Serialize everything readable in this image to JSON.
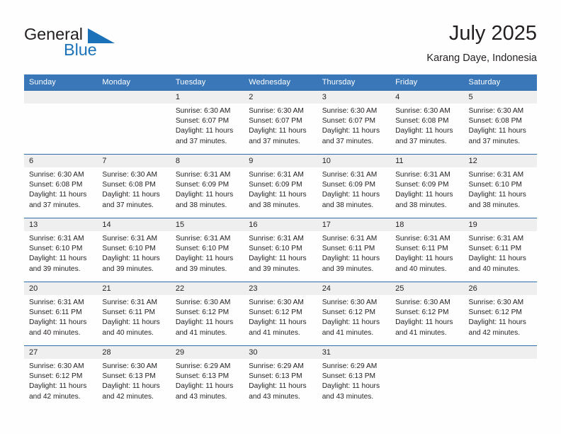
{
  "brand": {
    "name_top": "General",
    "name_bottom": "Blue",
    "triangle_color": "#1b72b8",
    "text_color": "#231f20",
    "blue_color": "#1b72b8"
  },
  "header": {
    "title": "July 2025",
    "subtitle": "Karang Daye, Indonesia"
  },
  "theme": {
    "header_blue": "#3a77b8",
    "rule_blue": "#2f6da8",
    "daynum_band": "#efefef",
    "text": "#231f20"
  },
  "calendar": {
    "weekdays": [
      "Sunday",
      "Monday",
      "Tuesday",
      "Wednesday",
      "Thursday",
      "Friday",
      "Saturday"
    ],
    "weeks": [
      [
        {
          "day": "",
          "empty": true
        },
        {
          "day": "",
          "empty": true
        },
        {
          "day": "1",
          "sunrise": "Sunrise: 6:30 AM",
          "sunset": "Sunset: 6:07 PM",
          "daylight1": "Daylight: 11 hours",
          "daylight2": "and 37 minutes."
        },
        {
          "day": "2",
          "sunrise": "Sunrise: 6:30 AM",
          "sunset": "Sunset: 6:07 PM",
          "daylight1": "Daylight: 11 hours",
          "daylight2": "and 37 minutes."
        },
        {
          "day": "3",
          "sunrise": "Sunrise: 6:30 AM",
          "sunset": "Sunset: 6:07 PM",
          "daylight1": "Daylight: 11 hours",
          "daylight2": "and 37 minutes."
        },
        {
          "day": "4",
          "sunrise": "Sunrise: 6:30 AM",
          "sunset": "Sunset: 6:08 PM",
          "daylight1": "Daylight: 11 hours",
          "daylight2": "and 37 minutes."
        },
        {
          "day": "5",
          "sunrise": "Sunrise: 6:30 AM",
          "sunset": "Sunset: 6:08 PM",
          "daylight1": "Daylight: 11 hours",
          "daylight2": "and 37 minutes."
        }
      ],
      [
        {
          "day": "6",
          "sunrise": "Sunrise: 6:30 AM",
          "sunset": "Sunset: 6:08 PM",
          "daylight1": "Daylight: 11 hours",
          "daylight2": "and 37 minutes."
        },
        {
          "day": "7",
          "sunrise": "Sunrise: 6:30 AM",
          "sunset": "Sunset: 6:08 PM",
          "daylight1": "Daylight: 11 hours",
          "daylight2": "and 37 minutes."
        },
        {
          "day": "8",
          "sunrise": "Sunrise: 6:31 AM",
          "sunset": "Sunset: 6:09 PM",
          "daylight1": "Daylight: 11 hours",
          "daylight2": "and 38 minutes."
        },
        {
          "day": "9",
          "sunrise": "Sunrise: 6:31 AM",
          "sunset": "Sunset: 6:09 PM",
          "daylight1": "Daylight: 11 hours",
          "daylight2": "and 38 minutes."
        },
        {
          "day": "10",
          "sunrise": "Sunrise: 6:31 AM",
          "sunset": "Sunset: 6:09 PM",
          "daylight1": "Daylight: 11 hours",
          "daylight2": "and 38 minutes."
        },
        {
          "day": "11",
          "sunrise": "Sunrise: 6:31 AM",
          "sunset": "Sunset: 6:09 PM",
          "daylight1": "Daylight: 11 hours",
          "daylight2": "and 38 minutes."
        },
        {
          "day": "12",
          "sunrise": "Sunrise: 6:31 AM",
          "sunset": "Sunset: 6:10 PM",
          "daylight1": "Daylight: 11 hours",
          "daylight2": "and 38 minutes."
        }
      ],
      [
        {
          "day": "13",
          "sunrise": "Sunrise: 6:31 AM",
          "sunset": "Sunset: 6:10 PM",
          "daylight1": "Daylight: 11 hours",
          "daylight2": "and 39 minutes."
        },
        {
          "day": "14",
          "sunrise": "Sunrise: 6:31 AM",
          "sunset": "Sunset: 6:10 PM",
          "daylight1": "Daylight: 11 hours",
          "daylight2": "and 39 minutes."
        },
        {
          "day": "15",
          "sunrise": "Sunrise: 6:31 AM",
          "sunset": "Sunset: 6:10 PM",
          "daylight1": "Daylight: 11 hours",
          "daylight2": "and 39 minutes."
        },
        {
          "day": "16",
          "sunrise": "Sunrise: 6:31 AM",
          "sunset": "Sunset: 6:10 PM",
          "daylight1": "Daylight: 11 hours",
          "daylight2": "and 39 minutes."
        },
        {
          "day": "17",
          "sunrise": "Sunrise: 6:31 AM",
          "sunset": "Sunset: 6:11 PM",
          "daylight1": "Daylight: 11 hours",
          "daylight2": "and 39 minutes."
        },
        {
          "day": "18",
          "sunrise": "Sunrise: 6:31 AM",
          "sunset": "Sunset: 6:11 PM",
          "daylight1": "Daylight: 11 hours",
          "daylight2": "and 40 minutes."
        },
        {
          "day": "19",
          "sunrise": "Sunrise: 6:31 AM",
          "sunset": "Sunset: 6:11 PM",
          "daylight1": "Daylight: 11 hours",
          "daylight2": "and 40 minutes."
        }
      ],
      [
        {
          "day": "20",
          "sunrise": "Sunrise: 6:31 AM",
          "sunset": "Sunset: 6:11 PM",
          "daylight1": "Daylight: 11 hours",
          "daylight2": "and 40 minutes."
        },
        {
          "day": "21",
          "sunrise": "Sunrise: 6:31 AM",
          "sunset": "Sunset: 6:11 PM",
          "daylight1": "Daylight: 11 hours",
          "daylight2": "and 40 minutes."
        },
        {
          "day": "22",
          "sunrise": "Sunrise: 6:30 AM",
          "sunset": "Sunset: 6:12 PM",
          "daylight1": "Daylight: 11 hours",
          "daylight2": "and 41 minutes."
        },
        {
          "day": "23",
          "sunrise": "Sunrise: 6:30 AM",
          "sunset": "Sunset: 6:12 PM",
          "daylight1": "Daylight: 11 hours",
          "daylight2": "and 41 minutes."
        },
        {
          "day": "24",
          "sunrise": "Sunrise: 6:30 AM",
          "sunset": "Sunset: 6:12 PM",
          "daylight1": "Daylight: 11 hours",
          "daylight2": "and 41 minutes."
        },
        {
          "day": "25",
          "sunrise": "Sunrise: 6:30 AM",
          "sunset": "Sunset: 6:12 PM",
          "daylight1": "Daylight: 11 hours",
          "daylight2": "and 41 minutes."
        },
        {
          "day": "26",
          "sunrise": "Sunrise: 6:30 AM",
          "sunset": "Sunset: 6:12 PM",
          "daylight1": "Daylight: 11 hours",
          "daylight2": "and 42 minutes."
        }
      ],
      [
        {
          "day": "27",
          "sunrise": "Sunrise: 6:30 AM",
          "sunset": "Sunset: 6:12 PM",
          "daylight1": "Daylight: 11 hours",
          "daylight2": "and 42 minutes."
        },
        {
          "day": "28",
          "sunrise": "Sunrise: 6:30 AM",
          "sunset": "Sunset: 6:13 PM",
          "daylight1": "Daylight: 11 hours",
          "daylight2": "and 42 minutes."
        },
        {
          "day": "29",
          "sunrise": "Sunrise: 6:29 AM",
          "sunset": "Sunset: 6:13 PM",
          "daylight1": "Daylight: 11 hours",
          "daylight2": "and 43 minutes."
        },
        {
          "day": "30",
          "sunrise": "Sunrise: 6:29 AM",
          "sunset": "Sunset: 6:13 PM",
          "daylight1": "Daylight: 11 hours",
          "daylight2": "and 43 minutes."
        },
        {
          "day": "31",
          "sunrise": "Sunrise: 6:29 AM",
          "sunset": "Sunset: 6:13 PM",
          "daylight1": "Daylight: 11 hours",
          "daylight2": "and 43 minutes."
        },
        {
          "day": "",
          "empty": true
        },
        {
          "day": "",
          "empty": true
        }
      ]
    ]
  }
}
